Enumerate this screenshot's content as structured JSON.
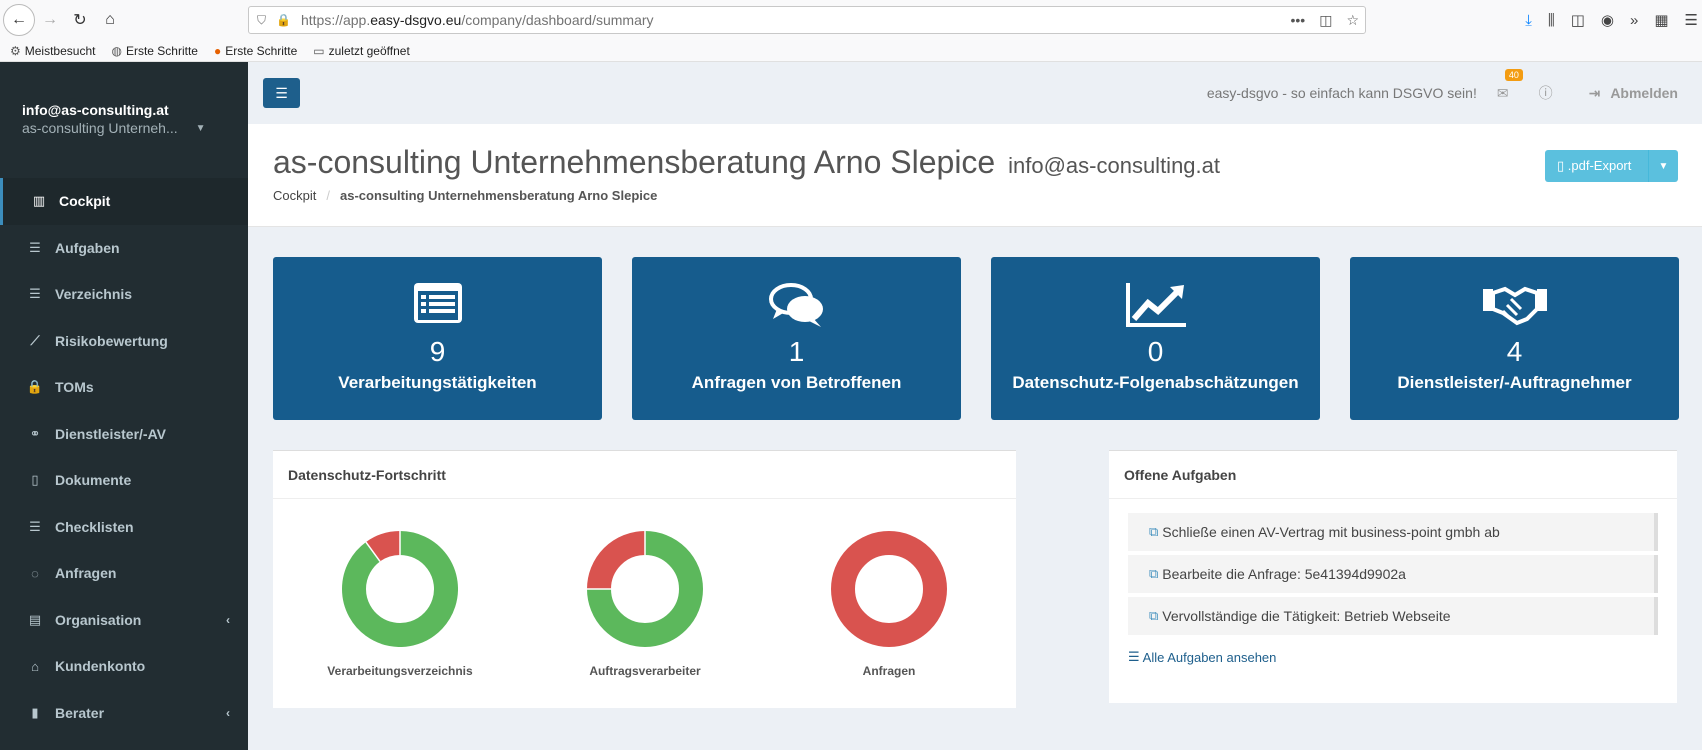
{
  "browser": {
    "url_prefix": "https://app.",
    "url_host": "easy-dsgvo.eu",
    "url_path": "/company/dashboard/summary",
    "bookmarks": [
      "Meistbesucht",
      "Erste Schritte",
      "Erste Schritte",
      "zuletzt geöffnet"
    ]
  },
  "sidebar": {
    "user_email": "info@as-consulting.at",
    "user_company": "as-consulting Unterneh...",
    "items": [
      {
        "label": "Cockpit",
        "icon": "bar-chart-icon",
        "glyph": "▥",
        "active": true
      },
      {
        "label": "Aufgaben",
        "icon": "tasks-icon",
        "glyph": "☰"
      },
      {
        "label": "Verzeichnis",
        "icon": "list-icon",
        "glyph": "☰"
      },
      {
        "label": "Risikobewertung",
        "icon": "line-chart-icon",
        "glyph": "⟋"
      },
      {
        "label": "TOMs",
        "icon": "lock-icon",
        "glyph": "🔒"
      },
      {
        "label": "Dienstleister/-AV",
        "icon": "handshake-icon",
        "glyph": "⚭"
      },
      {
        "label": "Dokumente",
        "icon": "file-icon",
        "glyph": "▯"
      },
      {
        "label": "Checklisten",
        "icon": "checklist-icon",
        "glyph": "☰"
      },
      {
        "label": "Anfragen",
        "icon": "comments-icon",
        "glyph": "◌"
      },
      {
        "label": "Organisation",
        "icon": "building-icon",
        "glyph": "▤",
        "chevron": true
      },
      {
        "label": "Kundenkonto",
        "icon": "bank-icon",
        "glyph": "⌂"
      },
      {
        "label": "Berater",
        "icon": "info-badge-icon",
        "glyph": "▮",
        "chevron": true
      }
    ]
  },
  "topbar": {
    "slogan": "easy-dsgvo - so einfach kann DSGVO sein!",
    "mail_badge": "40",
    "logout_label": "Abmelden"
  },
  "header": {
    "title": "as-consulting Unternehmensberatung Arno Slepice",
    "subtitle": "info@as-consulting.at",
    "breadcrumb_root": "Cockpit",
    "breadcrumb_current": "as-consulting Unternehmensberatung Arno Slepice",
    "pdf_export_label": ".pdf-Export"
  },
  "stats": [
    {
      "value": "9",
      "label": "Verarbeitungstätigkeiten",
      "icon": "list-alt-icon"
    },
    {
      "value": "1",
      "label": "Anfragen von Betroffenen",
      "icon": "comments-icon"
    },
    {
      "value": "0",
      "label": "Datenschutz-Folgenabschätzungen",
      "icon": "area-chart-icon"
    },
    {
      "value": "4",
      "label": "Dienstleister/-Auftragnehmer",
      "icon": "handshake-icon"
    }
  ],
  "progress_panel": {
    "title": "Datenschutz-Fortschritt",
    "chart_data": [
      {
        "type": "pie",
        "label": "Verarbeitungsverzeichnis",
        "slices": [
          {
            "name": "done",
            "value": 90,
            "color": "#5cb85c"
          },
          {
            "name": "open",
            "value": 10,
            "color": "#d9534f"
          }
        ]
      },
      {
        "type": "pie",
        "label": "Auftragsverarbeiter",
        "slices": [
          {
            "name": "done",
            "value": 75,
            "color": "#5cb85c"
          },
          {
            "name": "open",
            "value": 25,
            "color": "#d9534f"
          }
        ]
      },
      {
        "type": "pie",
        "label": "Anfragen",
        "slices": [
          {
            "name": "done",
            "value": 0,
            "color": "#5cb85c"
          },
          {
            "name": "open",
            "value": 100,
            "color": "#d9534f"
          }
        ]
      }
    ]
  },
  "tasks_panel": {
    "title": "Offene Aufgaben",
    "tasks": [
      "Schließe einen AV-Vertrag mit business-point gmbh ab",
      "Bearbeite die Anfrage: 5e41394d9902a",
      "Vervollständige die Tätigkeit: Betrieb Webseite"
    ],
    "all_tasks_label": "Alle Aufgaben ansehen"
  },
  "colors": {
    "sidebar_bg": "#222d32",
    "box_bg": "#165c8d",
    "accent": "#3c8dbc",
    "green": "#5cb85c",
    "red": "#d9534f",
    "info_btn": "#5bc0de"
  }
}
